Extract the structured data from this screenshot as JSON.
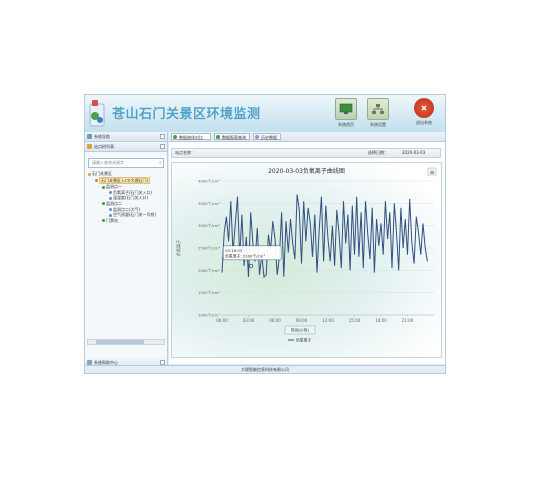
{
  "header": {
    "title": "苍山石门关景区环境监测",
    "buttons": [
      {
        "label": "系统首页",
        "icon": "monitor-icon"
      },
      {
        "label": "系统设置",
        "icon": "network-icon"
      },
      {
        "label": "退出系统",
        "icon": "exit-icon"
      }
    ]
  },
  "sidebar": {
    "nav_label": "系统导航",
    "panel_label": "站点树列表",
    "search_placeholder": "请输入查询关键字",
    "search_clear": "✕",
    "tree": [
      {
        "label": "石门关景区",
        "level": 0
      },
      {
        "label": "石门关景区入口(大理石门)",
        "level": 1,
        "selected": true
      },
      {
        "label": "监测点一",
        "level": 2
      },
      {
        "label": "负氧离子(石门关入口)",
        "level": 3
      },
      {
        "label": "温湿度(石门关入口)",
        "level": 3
      },
      {
        "label": "监测点二",
        "level": 2
      },
      {
        "label": "监测点二(大气)",
        "level": 3
      },
      {
        "label": "空气质量(石门关一号桥)",
        "level": 3
      },
      {
        "label": "门票站",
        "level": 2
      }
    ],
    "footer_label": "系统帮助中心"
  },
  "tabs": [
    {
      "label": "数据曲线对比"
    },
    {
      "label": "数据报表查询"
    },
    {
      "label": "历史数据"
    }
  ],
  "toolbar": {
    "left_label": "站点名称：",
    "right_label": "选择日期：",
    "date_value": "2020-03-03"
  },
  "status_text": "大理智能信息科技有限公司",
  "colors": {
    "brand_title": "#4f9fc9",
    "series_line": "#33507f"
  },
  "chart_data": {
    "type": "line",
    "title": "2020-03-03负氧离子曲线图",
    "ylabel": "负氧离子",
    "ylim": [
      1000,
      4000
    ],
    "y_ticks": [
      "1000个/cm³",
      "1500个/cm³",
      "2000个/cm³",
      "2500个/cm³",
      "3000个/cm³",
      "3500个/cm³",
      "4000个/cm³"
    ],
    "x_ticks": [
      "00:00",
      "03:00",
      "06:00",
      "09:00",
      "12:00",
      "15:00",
      "18:00",
      "21:00"
    ],
    "menu_icon": "≡",
    "tooltip": {
      "time": "03:18:03",
      "value_text": "负氧离子: 2100个/cm³",
      "x_hour": 3.3,
      "y": 2100
    },
    "navigator_label": "时间(小时)",
    "legend_label": "负氧离子",
    "series": [
      {
        "name": "负氧离子",
        "x_start_hour": 0,
        "x_step_hours": 0.25,
        "values": [
          1950,
          2850,
          3200,
          2650,
          3550,
          2400,
          3050,
          3650,
          2300,
          3250,
          2100,
          2750,
          1850,
          3300,
          2600,
          2200,
          2950,
          1900,
          2350,
          1850,
          1900,
          2800,
          2450,
          3100,
          2700,
          1900,
          2300,
          3300,
          1850,
          3100,
          2400,
          3150,
          2600,
          2250,
          3700,
          3350,
          2150,
          3550,
          2650,
          3400,
          3050,
          2300,
          3250,
          1950,
          2900,
          3650,
          2200,
          3450,
          2700,
          2200,
          3000,
          2100,
          3350,
          2850,
          2050,
          3550,
          2600,
          3250,
          2000,
          3450,
          2350,
          3650,
          2300,
          3300,
          2050,
          3550,
          2800,
          2250,
          3400,
          1950,
          3150,
          2550,
          3050,
          2350,
          3550,
          2700,
          3300,
          2050,
          3500,
          2850,
          2000,
          3400,
          2500,
          3150,
          2350,
          3600,
          2600,
          2150,
          3200,
          2850,
          2350,
          3050,
          2500,
          2200
        ]
      }
    ]
  }
}
